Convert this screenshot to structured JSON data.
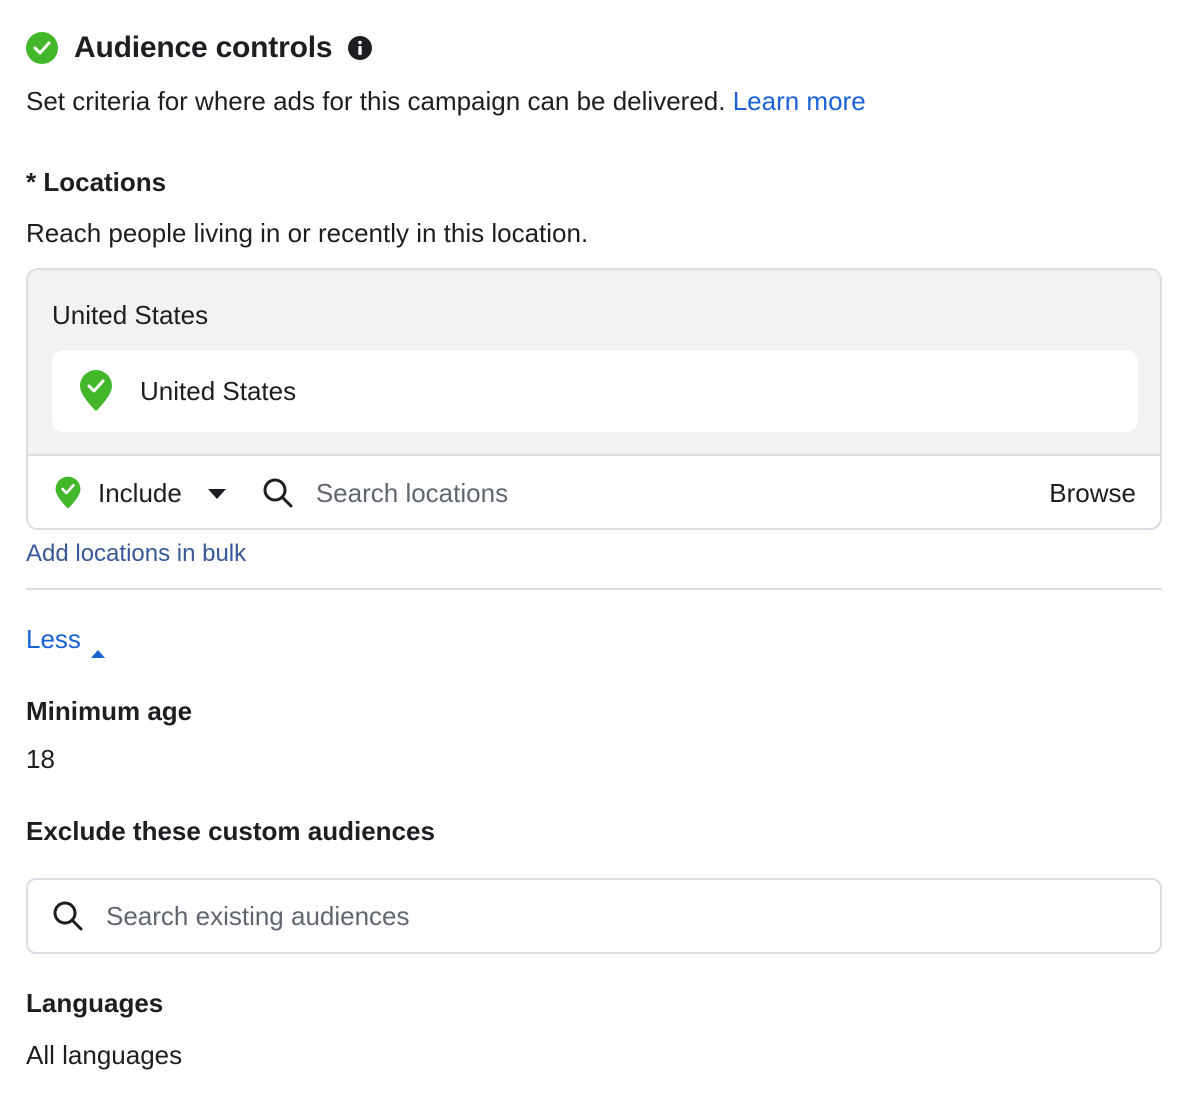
{
  "header": {
    "title": "Audience controls",
    "status_icon": "check-circle-icon",
    "info_icon": "info-icon"
  },
  "subtitle": {
    "text": "Set criteria for where ads for this campaign can be delivered.",
    "link": "Learn more"
  },
  "locations": {
    "label": "* Locations",
    "description": "Reach people living in or recently in this location.",
    "group_title": "United States",
    "items": [
      {
        "label": "United States",
        "icon": "location-pin-check-icon"
      }
    ],
    "mode": "Include",
    "search_placeholder": "Search locations",
    "browse_label": "Browse",
    "bulk_link": "Add locations in bulk"
  },
  "toggle": {
    "label": "Less"
  },
  "minimum_age": {
    "label": "Minimum age",
    "value": "18"
  },
  "exclude_audiences": {
    "label": "Exclude these custom audiences",
    "search_placeholder": "Search existing audiences"
  },
  "languages": {
    "label": "Languages",
    "value": "All languages"
  },
  "colors": {
    "accent_green": "#42b72a",
    "link_blue": "#1a62d4",
    "bulk_link_blue": "#385898",
    "border": "#dadde1",
    "panel_bg": "#f2f2f2",
    "text": "#1c1e21",
    "placeholder": "#606770"
  }
}
